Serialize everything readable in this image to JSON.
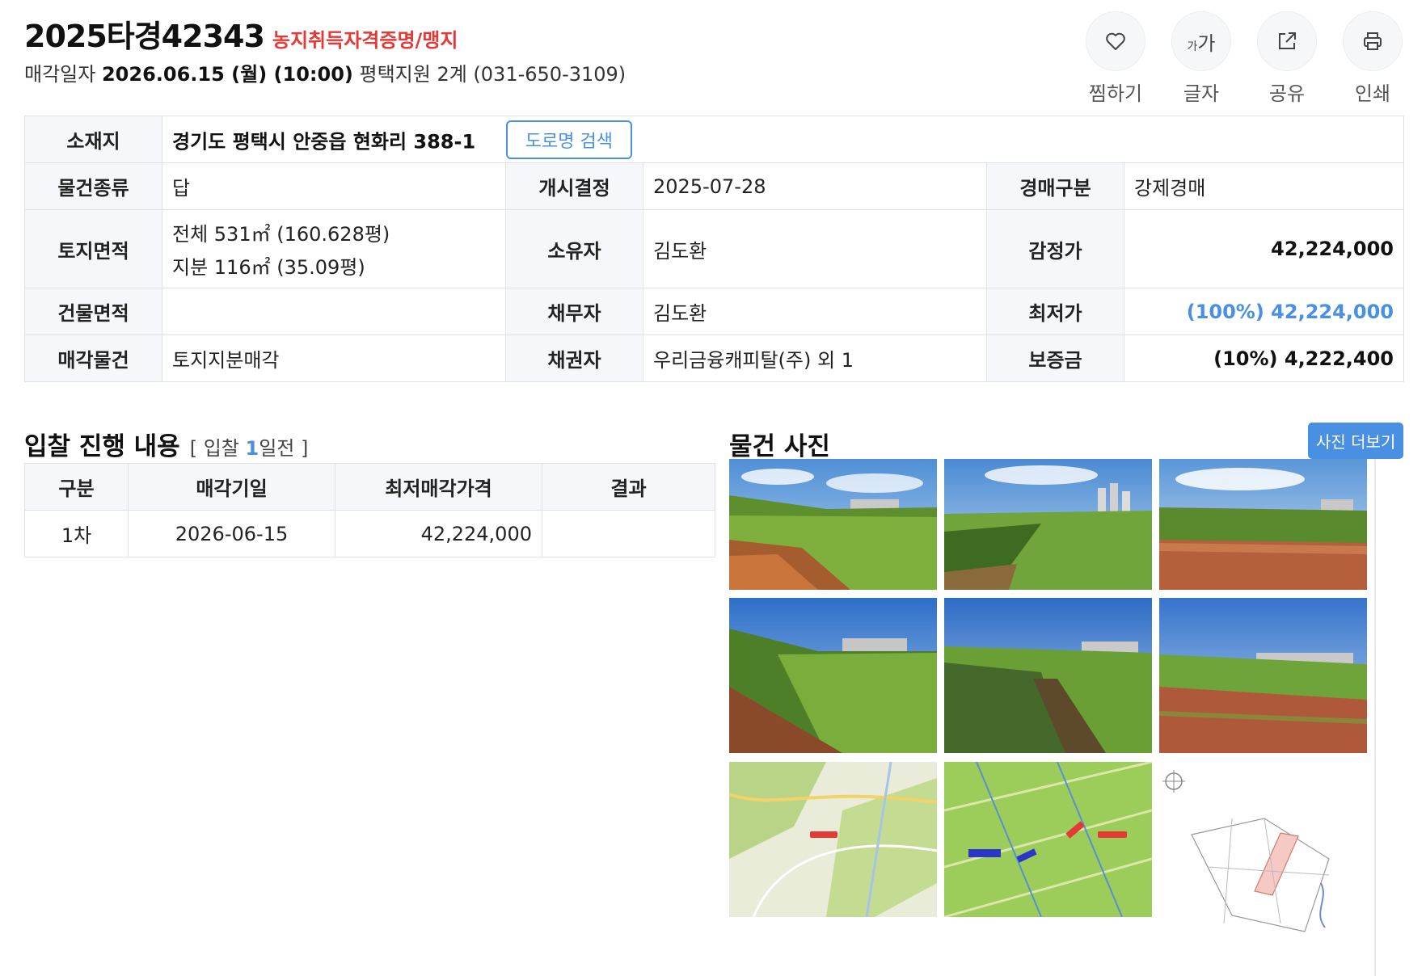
{
  "header": {
    "case_number": "2025타경42343",
    "flag": "농지취득자격증명/맹지",
    "sale_label": "매각일자",
    "sale_datetime": "2026.06.15 (월) (10:00)",
    "court": "평택지원 2계 (031-650-3109)"
  },
  "actions": [
    {
      "label": "찜하기",
      "icon": "heart-icon"
    },
    {
      "label": "글자",
      "icon": "font-size-icon",
      "glyph_small": "가",
      "glyph_large": "가"
    },
    {
      "label": "공유",
      "icon": "share-icon"
    },
    {
      "label": "인쇄",
      "icon": "print-icon"
    }
  ],
  "info": {
    "location_label": "소재지",
    "location_value": "경기도 평택시 안중읍 현화리 388-1",
    "road_search_button": "도로명 검색",
    "rows": [
      {
        "l1": "물건종류",
        "v1": "답",
        "l2": "개시결정",
        "v2": "2025-07-28",
        "l3": "경매구분",
        "v3": "강제경매"
      },
      {
        "l1": "토지면적",
        "v1a": "전체 531㎡ (160.628평)",
        "v1b": "지분 116㎡ (35.09평)",
        "l2": "소유자",
        "v2": "김도환",
        "l3": "감정가",
        "v3": "42,224,000"
      },
      {
        "l1": "건물면적",
        "v1": "",
        "l2": "채무자",
        "v2": "김도환",
        "l3": "최저가",
        "v3": "(100%) 42,224,000"
      },
      {
        "l1": "매각물건",
        "v1": "토지지분매각",
        "l2": "채권자",
        "v2": "우리금융캐피탈(주) 외 1",
        "l3": "보증금",
        "v3": "(10%) 4,222,400"
      }
    ]
  },
  "bid": {
    "title": "입찰 진행 내용",
    "sub_prefix": "[ 입찰 ",
    "sub_days": "1",
    "sub_suffix": "일전 ]",
    "columns": [
      "구분",
      "매각기일",
      "최저매각가격",
      "결과"
    ],
    "rows": [
      {
        "round": "1차",
        "date": "2026-06-15",
        "price": "42,224,000",
        "result": ""
      }
    ]
  },
  "photos": {
    "title": "물건 사진",
    "more_button": "사진 더보기",
    "items": [
      {
        "kind": "field",
        "name": "photo-field-1"
      },
      {
        "kind": "field",
        "name": "photo-field-2"
      },
      {
        "kind": "field",
        "name": "photo-field-3"
      },
      {
        "kind": "field",
        "name": "photo-field-4"
      },
      {
        "kind": "field",
        "name": "photo-field-5"
      },
      {
        "kind": "field",
        "name": "photo-field-6"
      },
      {
        "kind": "map",
        "name": "photo-map-1"
      },
      {
        "kind": "map",
        "name": "photo-map-2"
      },
      {
        "kind": "cadastral",
        "name": "photo-cadastral-map"
      }
    ]
  },
  "colors": {
    "accent": "#4a90e2",
    "flag": "#e53935",
    "header_cell": "#f5f7fa",
    "border": "#dfe3e8"
  }
}
